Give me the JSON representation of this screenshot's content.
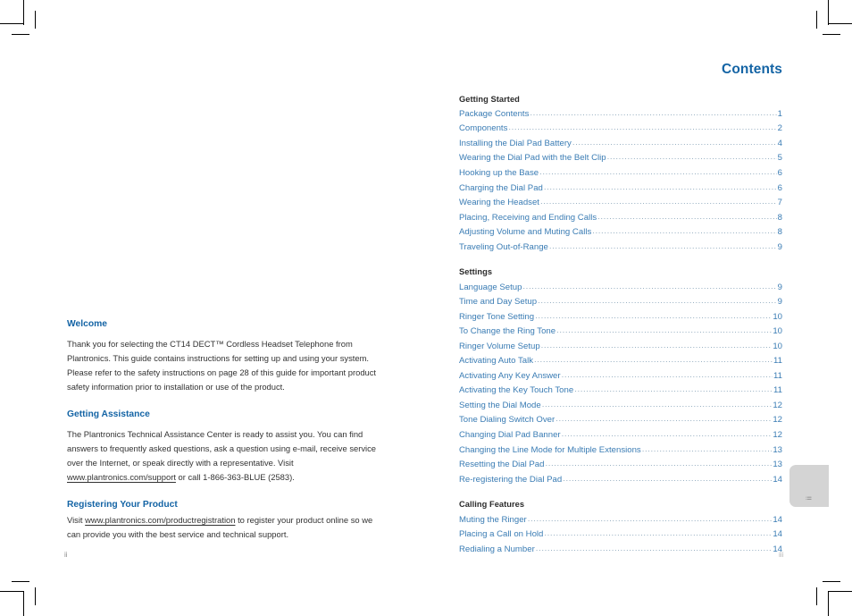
{
  "document": {
    "title": "Contents",
    "folio_left": "ii",
    "folio_right": "iii",
    "side_tab_label": "ii"
  },
  "colors": {
    "heading_blue": "#1464a5",
    "link_blue": "#3a7cb4",
    "section_dark": "#2b2b2b",
    "body_text": "#333333",
    "dot_leader": "#8fa9bd",
    "tab_gray": "#d4d4d4"
  },
  "contents": {
    "title": "Contents",
    "sections": [
      {
        "name": "Getting Started",
        "entries": [
          {
            "label": "Package Contents",
            "page": "1"
          },
          {
            "label": "Components",
            "page": "2"
          },
          {
            "label": "Installing the Dial Pad Battery",
            "page": "4"
          },
          {
            "label": "Wearing the Dial Pad with the Belt Clip",
            "page": "5"
          },
          {
            "label": "Hooking up the Base",
            "page": "6"
          },
          {
            "label": "Charging the Dial Pad",
            "page": "6"
          },
          {
            "label": "Wearing the Headset",
            "page": "7"
          },
          {
            "label": "Placing, Receiving and Ending Calls",
            "page": "8"
          },
          {
            "label": "Adjusting Volume and Muting Calls",
            "page": "8"
          },
          {
            "label": "Traveling Out-of-Range",
            "page": "9"
          }
        ]
      },
      {
        "name": "Settings",
        "entries": [
          {
            "label": "Language Setup",
            "page": "9"
          },
          {
            "label": "Time and Day Setup",
            "page": "9"
          },
          {
            "label": "Ringer Tone Setting",
            "page": "10"
          },
          {
            "label": "To Change the Ring Tone",
            "page": "10"
          },
          {
            "label": "Ringer Volume Setup",
            "page": "10"
          },
          {
            "label": "Activating Auto Talk",
            "page": "11"
          },
          {
            "label": "Activating Any Key Answer",
            "page": "11"
          },
          {
            "label": "Activating the Key Touch Tone",
            "page": "11"
          },
          {
            "label": "Setting the Dial Mode",
            "page": "12"
          },
          {
            "label": "Tone Dialing Switch Over",
            "page": "12"
          },
          {
            "label": "Changing Dial Pad Banner",
            "page": "12"
          },
          {
            "label": "Changing the Line Mode for Multiple Extensions",
            "page": "13"
          },
          {
            "label": "Resetting the Dial Pad",
            "page": "13"
          },
          {
            "label": "Re-registering the Dial Pad",
            "page": "14"
          }
        ]
      },
      {
        "name": "Calling Features",
        "entries": [
          {
            "label": "Muting the Ringer",
            "page": "14"
          },
          {
            "label": "Placing a Call on Hold",
            "page": "14"
          },
          {
            "label": "Redialing a Number",
            "page": "14"
          }
        ]
      }
    ]
  },
  "left_column": {
    "welcome": {
      "heading": "Welcome",
      "body": "Thank you for selecting the CT14 DECT™ Cordless Headset Telephone from Plantronics. This guide contains instructions for setting up and using your system. Please refer to the safety instructions on page 28 of this guide for important product safety information prior to installation or use of the product."
    },
    "assistance": {
      "heading": "Getting Assistance",
      "body_before_link": "The Plantronics Technical Assistance Center is ready to assist you. You can find answers to frequently asked questions, ask a question using e-mail, receive service over the Internet, or speak directly with a representative. Visit ",
      "link": "www.plantronics.com/support",
      "body_after_link": " or call 1-866-363-BLUE (2583)."
    },
    "registering": {
      "heading": "Registering Your Product",
      "body_before_link": "Visit ",
      "link": "www.plantronics.com/productregistration",
      "body_after_link": " to register your product online so we can provide you with the best service and technical support."
    }
  }
}
